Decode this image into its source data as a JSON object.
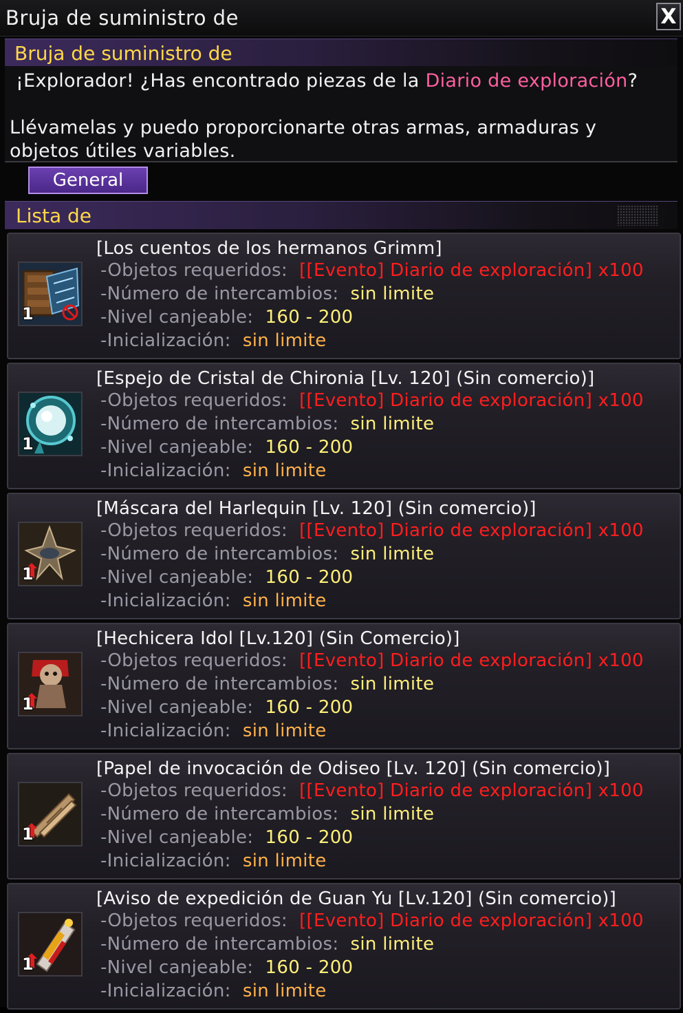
{
  "window": {
    "title": "Bruja de suministro de",
    "close_label": "X"
  },
  "npc": {
    "name": "Bruja de suministro de",
    "line1_pre": "¡Explorador! ¿Has encontrado piezas de la ",
    "line1_highlight": "Diario de exploración",
    "line1_post": "?",
    "line2": "Llévamelas y puedo proporcionarte otras armas, armaduras y objetos útiles variables."
  },
  "tabs": [
    {
      "label": "General"
    }
  ],
  "list": {
    "header": "Lista de",
    "labels": {
      "required": "-Objetos requeridos:",
      "exchanges": "-Número de intercambios:",
      "level": "-Nivel canjeable:",
      "reset": "-Inicialización:"
    },
    "items": [
      {
        "name": "[Los cuentos de los hermanos Grimm]",
        "icon": "book-icon",
        "quantity": "1",
        "required": "[[Evento] Diario de exploración] x100",
        "exchanges": "sin limite",
        "level": "160 - 200",
        "reset": "sin limite"
      },
      {
        "name": "[Espejo de Cristal de Chironia [Lv. 120] (Sin comercio)]",
        "icon": "crystal-mirror-icon",
        "quantity": "1",
        "required": "[[Evento] Diario de exploración] x100",
        "exchanges": "sin limite",
        "level": "160 - 200",
        "reset": "sin limite"
      },
      {
        "name": "[Máscara del Harlequin [Lv. 120] (Sin comercio)]",
        "icon": "harlequin-mask-icon",
        "quantity": "1",
        "required": "[[Evento] Diario de exploración] x100",
        "exchanges": "sin limite",
        "level": "160 - 200",
        "reset": "sin limite"
      },
      {
        "name": "[Hechicera Idol [Lv.120] (Sin Comercio)]",
        "icon": "idol-doll-icon",
        "quantity": "1",
        "required": "[[Evento] Diario de exploración] x100",
        "exchanges": "sin limite",
        "level": "160 - 200",
        "reset": "sin limite"
      },
      {
        "name": "[Papel de invocación de Odiseo [Lv. 120] (Sin comercio)]",
        "icon": "scroll-icon",
        "quantity": "1",
        "required": "[[Evento] Diario de exploración] x100",
        "exchanges": "sin limite",
        "level": "160 - 200",
        "reset": "sin limite"
      },
      {
        "name": "[Aviso de expedición de Guan Yu [Lv.120] (Sin comercio)]",
        "icon": "firecracker-icon",
        "quantity": "1",
        "required": "[[Evento] Diario de exploración] x100",
        "exchanges": "sin limite",
        "level": "160 - 200",
        "reset": "sin limite"
      }
    ]
  }
}
